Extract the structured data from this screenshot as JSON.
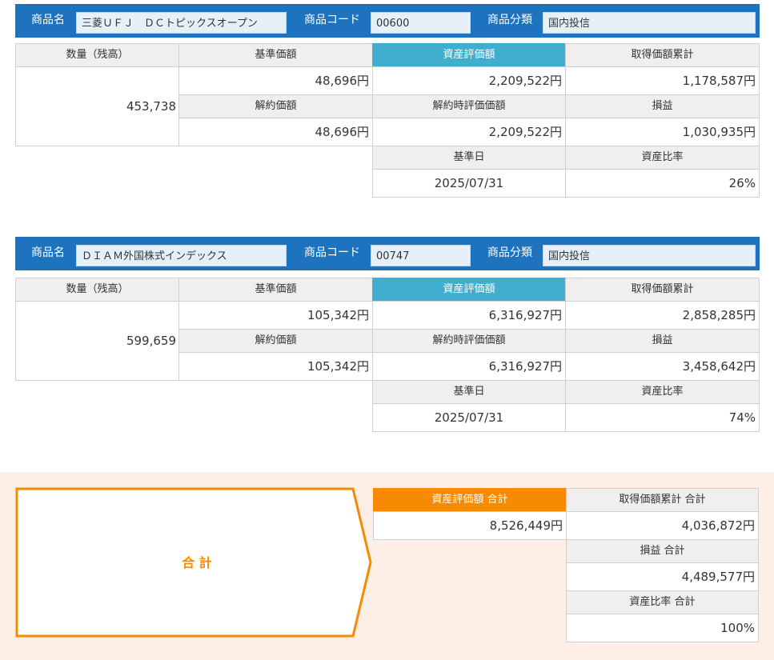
{
  "labels": {
    "product_name": "商品名",
    "product_code": "商品コード",
    "product_category": "商品分類",
    "quantity": "数量（残高）",
    "base_price": "基準価額",
    "asset_valuation": "資産評価額",
    "acquisition_total": "取得価額累計",
    "cancel_price": "解約価額",
    "cancel_valuation": "解約時評価価額",
    "profit_loss": "損益",
    "base_date": "基準日",
    "asset_ratio": "資産比率"
  },
  "funds": [
    {
      "name": "三菱ＵＦＪ　ＤＣトピックスオープン",
      "code": "00600",
      "category": "国内投信",
      "quantity": "453,738",
      "base_price": "48,696円",
      "asset_valuation": "2,209,522円",
      "acquisition_total": "1,178,587円",
      "cancel_price": "48,696円",
      "cancel_valuation": "2,209,522円",
      "profit_loss": "1,030,935円",
      "base_date": "2025/07/31",
      "asset_ratio": "26%"
    },
    {
      "name": "ＤＩＡＭ外国株式インデックス",
      "code": "00747",
      "category": "国内投信",
      "quantity": "599,659",
      "base_price": "105,342円",
      "asset_valuation": "6,316,927円",
      "acquisition_total": "2,858,285円",
      "cancel_price": "105,342円",
      "cancel_valuation": "6,316,927円",
      "profit_loss": "3,458,642円",
      "base_date": "2025/07/31",
      "asset_ratio": "74%"
    }
  ],
  "totals": {
    "title": "合 計",
    "asset_valuation_label": "資産評価額 合計",
    "asset_valuation": "8,526,449円",
    "acquisition_label": "取得価額累計 合計",
    "acquisition": "4,036,872円",
    "profit_loss_label": "損益 合計",
    "profit_loss": "4,489,577円",
    "asset_ratio_label": "資産比率 合計",
    "asset_ratio": "100%"
  },
  "colors": {
    "header_bar": "#1e73be",
    "highlight_blue": "#41aecf",
    "highlight_orange": "#f78a00",
    "total_background": "#fdefe6"
  }
}
